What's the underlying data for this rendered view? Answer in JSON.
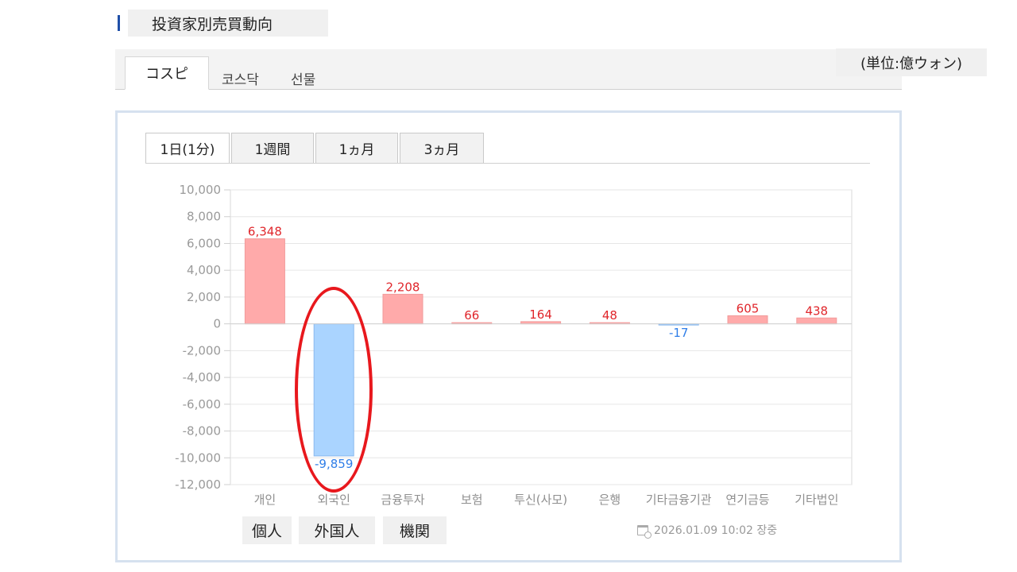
{
  "header": {
    "title": "投資家別売買動向",
    "unit": "(単位:億ウォン)"
  },
  "market_tabs": [
    {
      "label": "コスピ",
      "active": true
    },
    {
      "label": "코스닥",
      "active": false
    },
    {
      "label": "선물",
      "active": false
    }
  ],
  "period_tabs": [
    {
      "label": "1日(1分)",
      "active": true
    },
    {
      "label": "1週間",
      "active": false
    },
    {
      "label": "1ヵ月",
      "active": false
    },
    {
      "label": "3ヵ月",
      "active": false
    }
  ],
  "translations": [
    "個人",
    "外国人",
    "機関"
  ],
  "timestamp": "2026.01.09 10:02 장중",
  "colors": {
    "positive_fill": "#ffaaaa",
    "positive_label": "#e0262b",
    "negative_fill": "#aad4ff",
    "negative_label": "#2f7ee8",
    "highlight": "#e8181d",
    "panel_border": "#d6e1ef"
  },
  "chart_data": {
    "type": "bar",
    "categories": [
      "개인",
      "외국인",
      "금융투자",
      "보험",
      "투신(사모)",
      "은행",
      "기타금융기관",
      "연기금등",
      "기타법인"
    ],
    "values": [
      6348,
      -9859,
      2208,
      66,
      164,
      48,
      -17,
      605,
      438
    ],
    "value_labels": [
      "6,348",
      "-9,859",
      "2,208",
      "66",
      "164",
      "48",
      "-17",
      "605",
      "438"
    ],
    "yticks": [
      "10,000",
      "8,000",
      "6,000",
      "4,000",
      "2,000",
      "0",
      "-2,000",
      "-4,000",
      "-6,000",
      "-8,000",
      "-10,000",
      "-12,000"
    ],
    "ylim": [
      -12000,
      10000
    ],
    "grid": true,
    "highlighted_category": "외국인"
  }
}
